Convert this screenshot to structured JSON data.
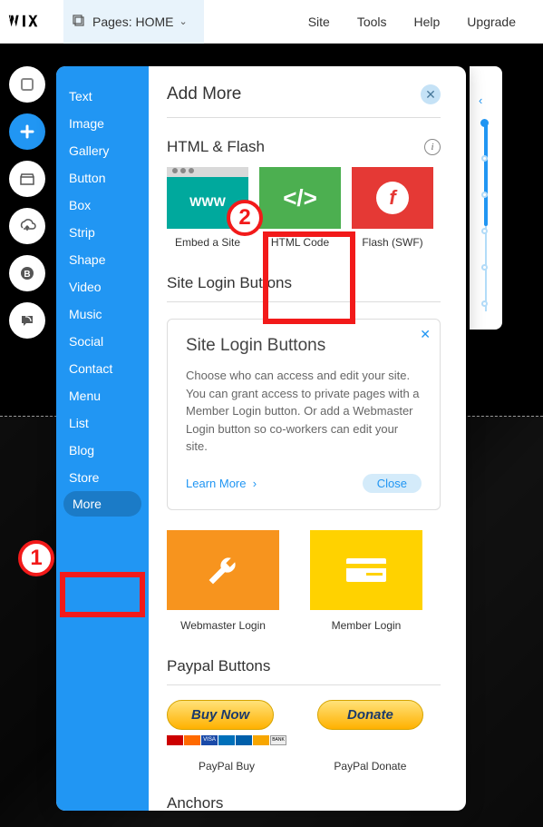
{
  "topbar": {
    "pages_label": "Pages: HOME",
    "nav": {
      "site": "Site",
      "tools": "Tools",
      "help": "Help",
      "upgrade": "Upgrade"
    }
  },
  "categories": {
    "items": [
      "Text",
      "Image",
      "Gallery",
      "Button",
      "Box",
      "Strip",
      "Shape",
      "Video",
      "Music",
      "Social",
      "Contact",
      "Menu",
      "List",
      "Blog",
      "Store",
      "More"
    ],
    "active": "More"
  },
  "panel": {
    "title": "Add More",
    "sections": {
      "html": {
        "title": "HTML & Flash",
        "items": [
          {
            "label": "Embed a Site",
            "icon_text": "WWW"
          },
          {
            "label": "HTML Code",
            "icon_text": "</>"
          },
          {
            "label": "Flash (SWF)",
            "icon_text": "f"
          }
        ]
      },
      "login": {
        "title": "Site Login Buttons",
        "card": {
          "title": "Site Login Buttons",
          "body": "Choose who can access and edit your site. You can grant access to private pages with a Member Login button. Or add a Webmaster Login button so co-workers can edit your site.",
          "learn": "Learn More",
          "close": "Close"
        },
        "tiles": {
          "webmaster": "Webmaster Login",
          "member": "Member Login"
        }
      },
      "paypal": {
        "title": "Paypal Buttons",
        "buy": {
          "btn": "Buy Now",
          "label": "PayPal Buy"
        },
        "donate": {
          "btn": "Donate",
          "label": "PayPal Donate"
        }
      },
      "anchors": {
        "title": "Anchors"
      }
    }
  },
  "annotations": {
    "badge1": "1",
    "badge2": "2"
  }
}
